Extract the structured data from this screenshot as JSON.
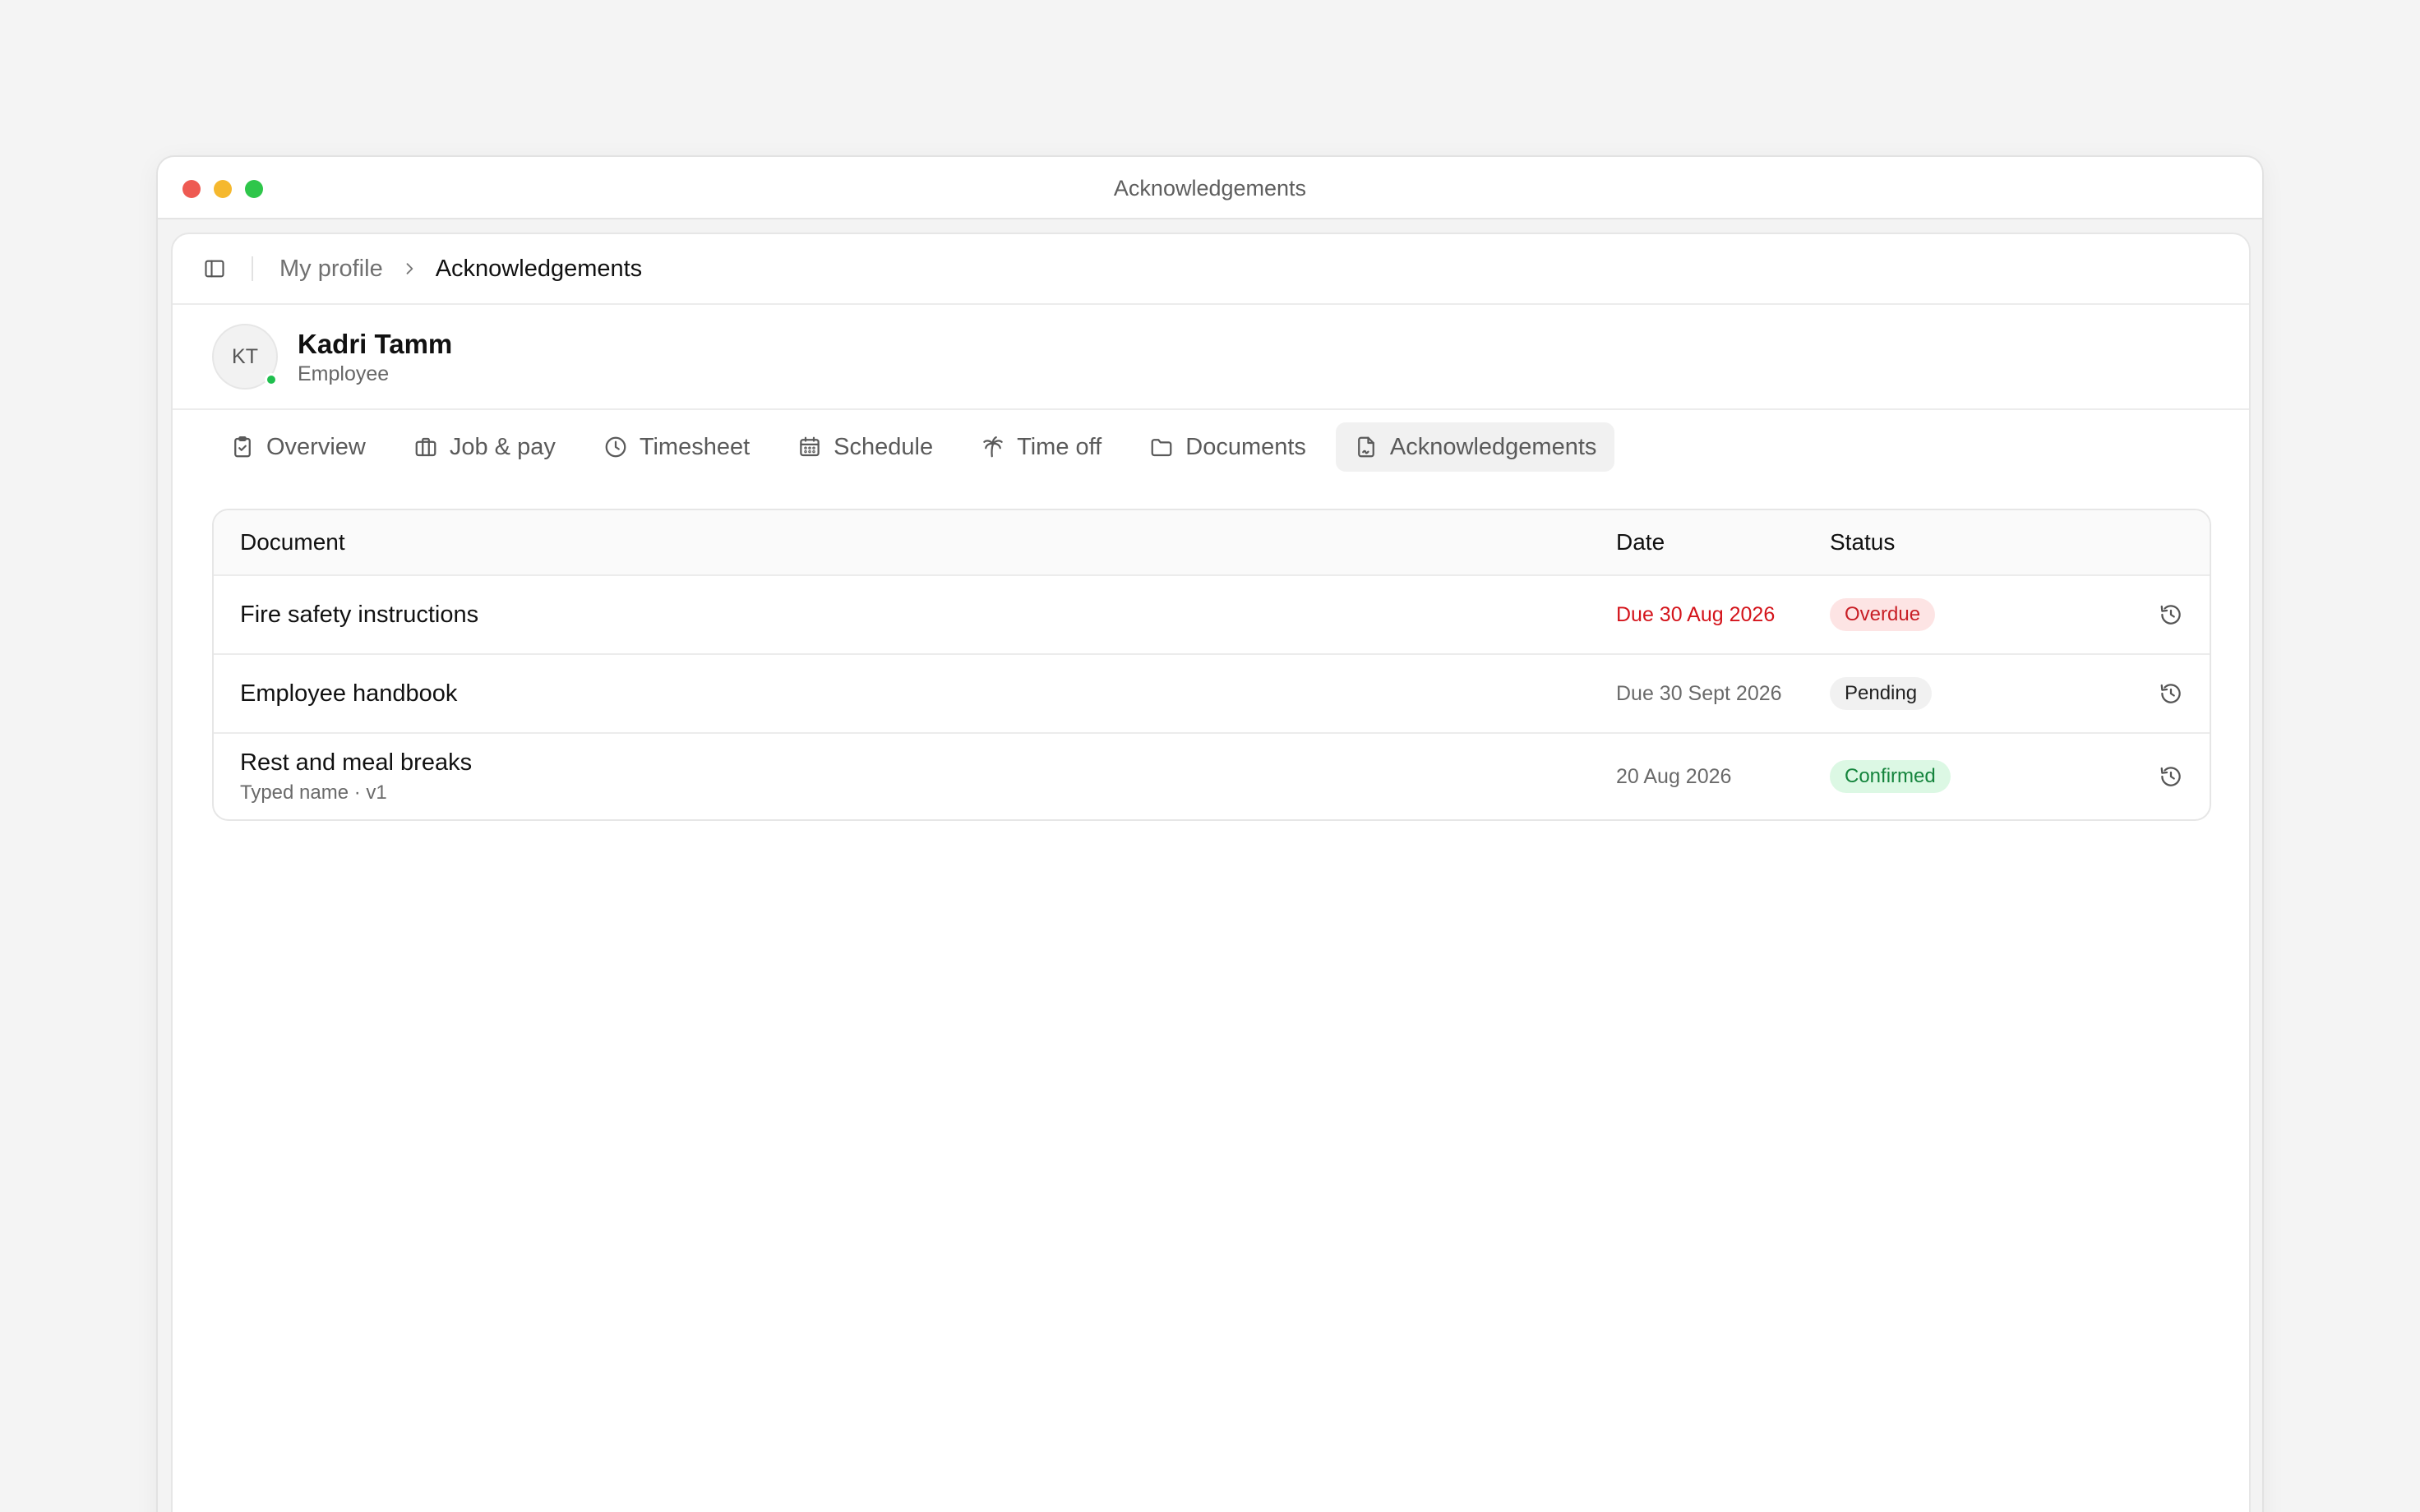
{
  "window": {
    "title": "Acknowledgements"
  },
  "breadcrumb": {
    "parent": "My profile",
    "current": "Acknowledgements"
  },
  "profile": {
    "initials": "KT",
    "name": "Kadri Tamm",
    "role": "Employee",
    "presence": "online"
  },
  "tabs": [
    {
      "label": "Overview",
      "icon": "clipboard-check-icon"
    },
    {
      "label": "Job & pay",
      "icon": "briefcase-icon"
    },
    {
      "label": "Timesheet",
      "icon": "clock-icon"
    },
    {
      "label": "Schedule",
      "icon": "calendar-icon"
    },
    {
      "label": "Time off",
      "icon": "palm-tree-icon"
    },
    {
      "label": "Documents",
      "icon": "folder-icon"
    },
    {
      "label": "Acknowledgements",
      "icon": "file-signature-icon",
      "active": true
    }
  ],
  "table": {
    "headers": {
      "document": "Document",
      "date": "Date",
      "status": "Status"
    },
    "rows": [
      {
        "title": "Fire safety instructions",
        "subtitle": "",
        "date": "Due 30 Aug 2026",
        "status": "Overdue"
      },
      {
        "title": "Employee handbook",
        "subtitle": "",
        "date": "Due 30 Sept 2026",
        "status": "Pending"
      },
      {
        "title": "Rest and meal breaks",
        "subtitle": "Typed name · v1",
        "date": "20 Aug 2026",
        "status": "Confirmed"
      }
    ]
  },
  "colors": {
    "overdue_text": "#d4141b",
    "overdue_badge_bg": "#fde4e4",
    "confirmed_badge_bg": "#dcf8e4",
    "confirmed_text": "#14843c",
    "presence": "#1fbf4e"
  }
}
